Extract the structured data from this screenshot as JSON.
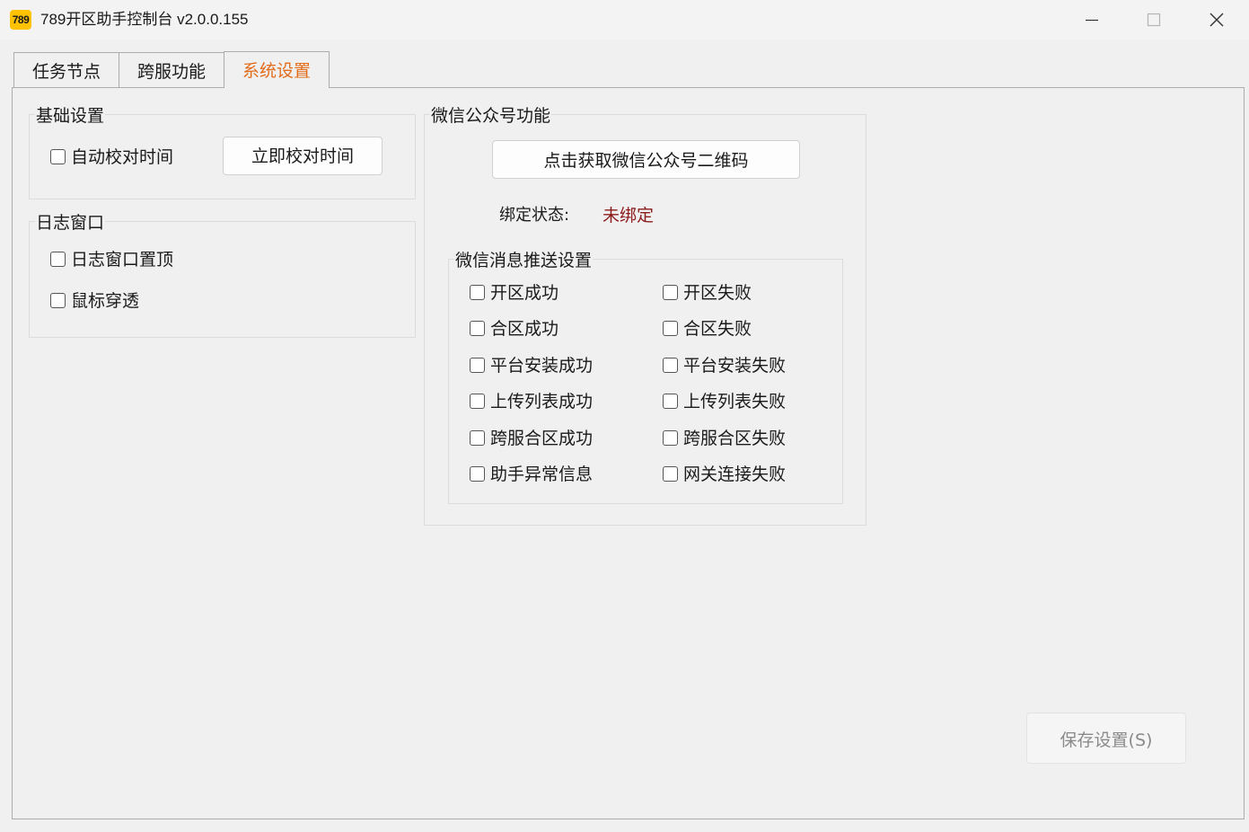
{
  "app": {
    "logo_text": "789",
    "title": "789开区助手控制台 v2.0.0.155"
  },
  "tabs": [
    {
      "label": "任务节点",
      "active": false
    },
    {
      "label": "跨服功能",
      "active": false
    },
    {
      "label": "系统设置",
      "active": true
    }
  ],
  "basic": {
    "title": "基础设置",
    "auto_sync_label": "自动校对时间",
    "sync_now_label": "立即校对时间"
  },
  "log_window": {
    "title": "日志窗口",
    "pin_top_label": "日志窗口置顶",
    "mouse_through_label": "鼠标穿透"
  },
  "wechat": {
    "title": "微信公众号功能",
    "qr_button_label": "点击获取微信公众号二维码",
    "bind_status_label": "绑定状态:",
    "bind_status_value": "未绑定",
    "push": {
      "title": "微信消息推送设置",
      "left": [
        "开区成功",
        "合区成功",
        "平台安装成功",
        "上传列表成功",
        "跨服合区成功",
        "助手异常信息"
      ],
      "right": [
        "开区失败",
        "合区失败",
        "平台安装失败",
        "上传列表失败",
        "跨服合区失败",
        "网关连接失败"
      ]
    }
  },
  "save_button_label": "保存设置(S)",
  "colors": {
    "active_tab": "#e36b1a",
    "status_unbound": "#8b1a1a",
    "logo_bg": "#ffc200"
  }
}
